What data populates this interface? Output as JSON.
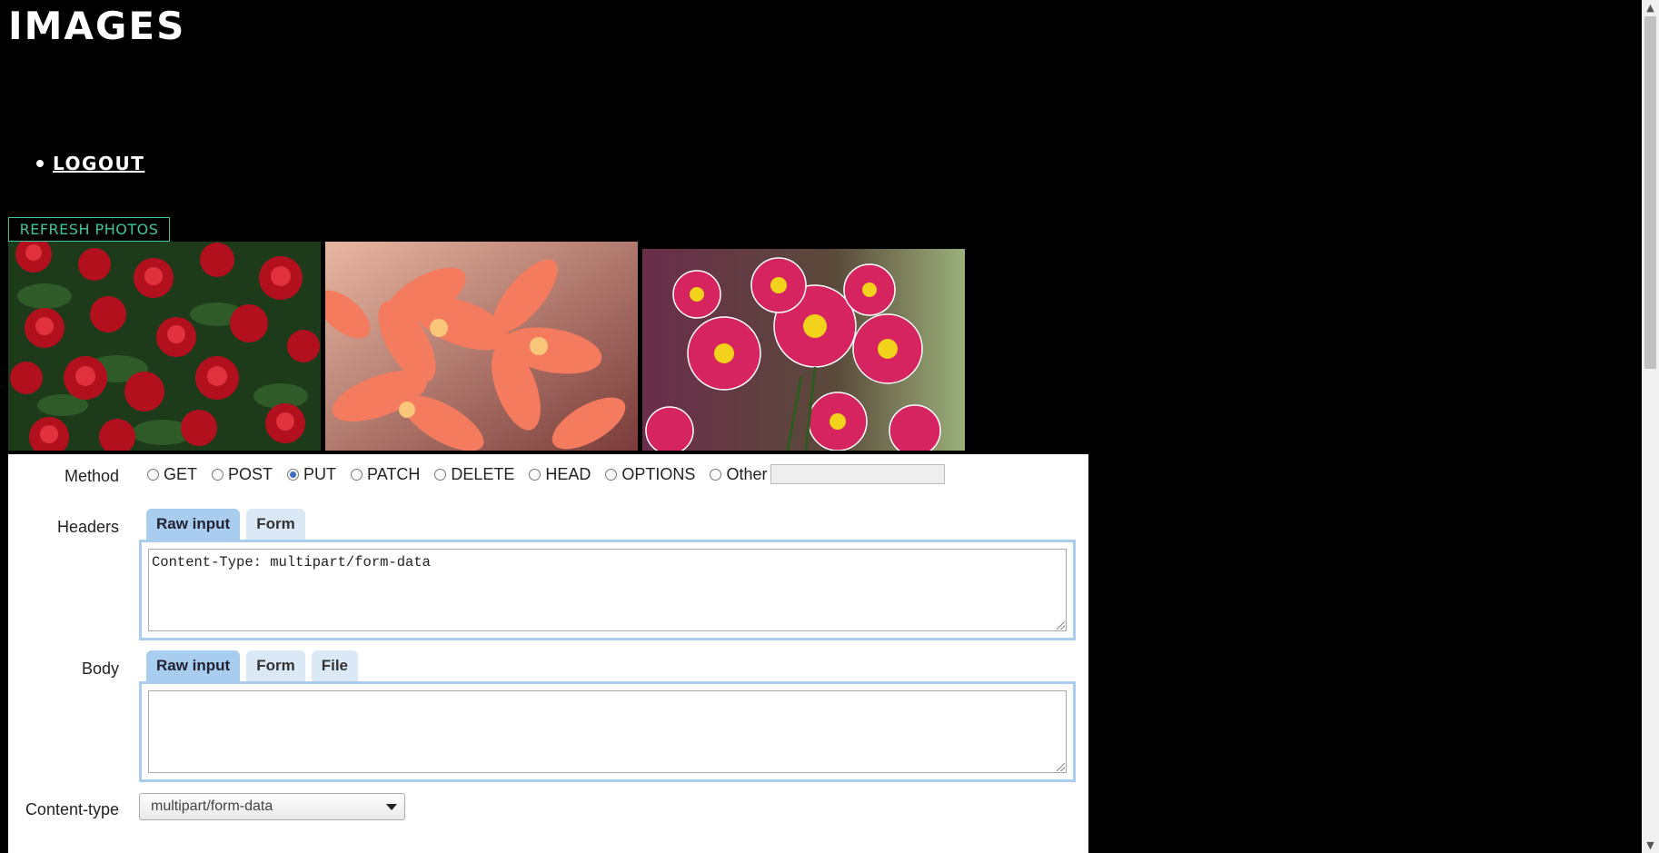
{
  "header": {
    "title": "IMAGES"
  },
  "nav": {
    "items": [
      {
        "label": "LOGOUT"
      }
    ]
  },
  "toolbar": {
    "refresh_label": "REFRESH PHOTOS"
  },
  "photos": [
    {
      "subject": "red roses"
    },
    {
      "subject": "orange lilies"
    },
    {
      "subject": "pink daisies"
    }
  ],
  "request": {
    "method_label": "Method",
    "methods": [
      "GET",
      "POST",
      "PUT",
      "PATCH",
      "DELETE",
      "HEAD",
      "OPTIONS",
      "Other"
    ],
    "selected_method": "PUT",
    "other_value": "",
    "headers_label": "Headers",
    "header_tabs": [
      "Raw input",
      "Form"
    ],
    "headers_text": "Content-Type: multipart/form-data",
    "body_label": "Body",
    "body_tabs": [
      "Raw input",
      "Form",
      "File"
    ],
    "body_text": "",
    "content_type_label": "Content-type",
    "content_type_value": "multipart/form-data"
  },
  "colors": {
    "accent": "#3fc4a0",
    "tab_active": "#a9cdee",
    "tab_inactive": "#dbe9f6"
  }
}
